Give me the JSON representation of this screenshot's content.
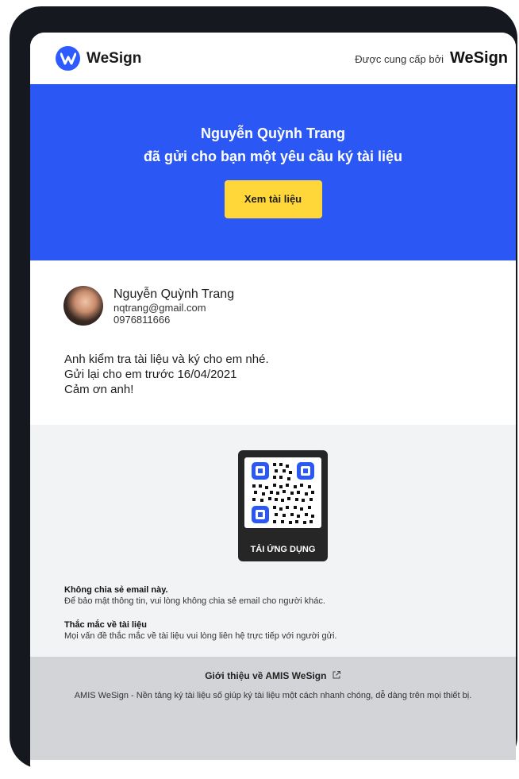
{
  "header": {
    "brand_name": "WeSign",
    "provided_by_label": "Được cung cấp bởi",
    "provided_by_brand": "WeSign"
  },
  "hero": {
    "sender_name": "Nguyễn Quỳnh Trang",
    "subtitle": "đã gửi cho bạn một yêu cầu ký tài liệu",
    "button_label": "Xem tài liệu"
  },
  "sender": {
    "name": "Nguyễn Quỳnh Trang",
    "email": "nqtrang@gmail.com",
    "phone": "0976811666"
  },
  "message": {
    "line1": "Anh kiểm tra tài liệu và ký cho em nhé.",
    "line2": "Gửi lại cho em trước 16/04/2021",
    "line3": "Cảm ơn anh!"
  },
  "qr": {
    "label": "TẢI ỨNG DỤNG"
  },
  "notices": {
    "share_title": "Không chia sẻ email này.",
    "share_text": "Để bảo mật thông tin, vui lòng không chia sẻ email cho người khác.",
    "question_title": "Thắc mắc về tài liệu",
    "question_text": "Mọi vấn đề thắc mắc về tài liệu vui lòng liên hệ trực tiếp với người gửi."
  },
  "footer": {
    "about_title": "Giới thiệu về AMIS WeSign",
    "description": "AMIS WeSign - Nền tảng ký tài liệu số giúp ký tài liệu một cách nhanh chóng, dễ dàng trên mọi thiết bị."
  },
  "colors": {
    "primary": "#2b58f5",
    "cta": "#ffd739",
    "device_frame": "#15191f"
  }
}
